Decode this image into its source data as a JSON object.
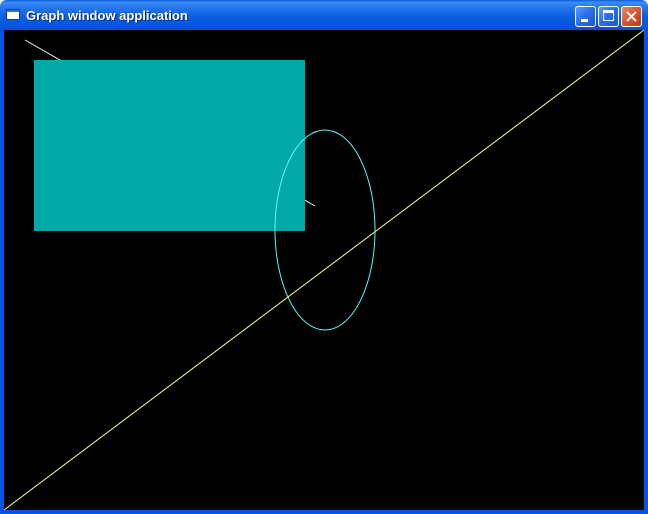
{
  "window": {
    "title": "Graph window application",
    "icon": "window-icon"
  },
  "titlebar_buttons": [
    {
      "name": "minimize",
      "icon": "minimize-icon"
    },
    {
      "name": "maximize",
      "icon": "maximize-icon"
    },
    {
      "name": "close",
      "icon": "close-icon"
    }
  ],
  "canvas": {
    "background": "#000000",
    "shapes": [
      {
        "kind": "line",
        "color": "#ffffff"
      },
      {
        "kind": "filled-rectangle",
        "color": "#00a8a8"
      },
      {
        "kind": "ellipse-outline",
        "color": "#55ffff"
      },
      {
        "kind": "line",
        "color": "#ffff55"
      }
    ]
  },
  "colors": {
    "titlebar": "#0a5fe0",
    "close_button": "#d9532f"
  }
}
